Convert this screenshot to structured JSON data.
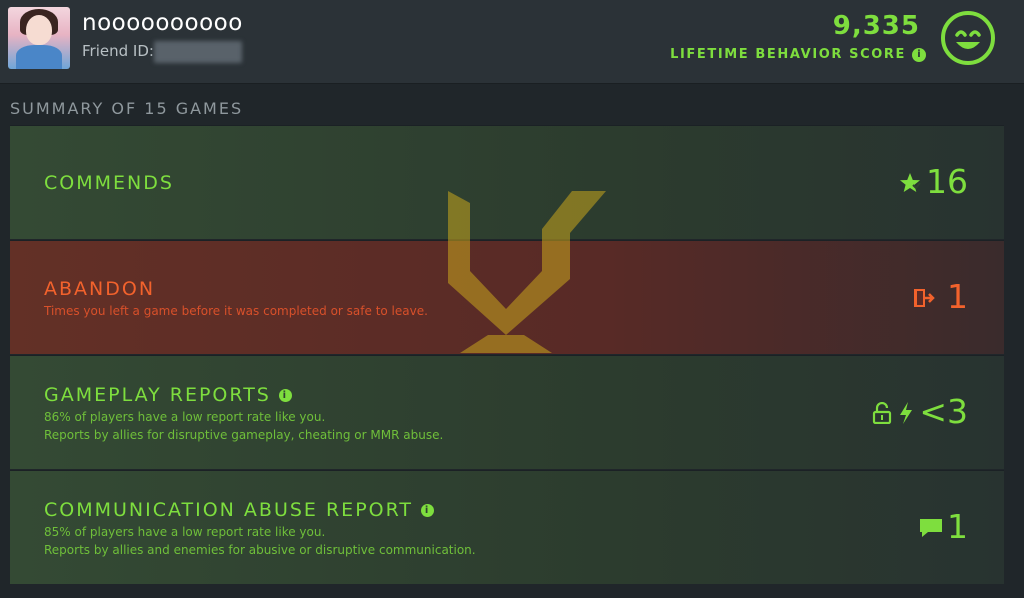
{
  "header": {
    "username": "noooooooooo",
    "friend_id_label": "Friend ID:",
    "score": "9,335",
    "score_label": "LIFETIME BEHAVIOR SCORE"
  },
  "summary_title": "SUMMARY OF 15 GAMES",
  "panels": {
    "commends": {
      "title": "COMMENDS",
      "value": "16",
      "icon": "star-icon"
    },
    "abandon": {
      "title": "ABANDON",
      "desc": "Times you left a game before it was completed or safe to leave.",
      "value": "1",
      "icon": "exit-door-icon"
    },
    "gameplay": {
      "title": "GAMEPLAY REPORTS",
      "desc1": "86% of players have a low report rate like you.",
      "desc2": "Reports by allies for disruptive gameplay, cheating or MMR abuse.",
      "value": "<3",
      "icons": [
        "lock-icon",
        "lightning-icon"
      ]
    },
    "comm": {
      "title": "COMMUNICATION ABUSE REPORT",
      "desc1": "85% of players have a low report rate like you.",
      "desc2": "Reports by allies and enemies for abusive or disruptive communication.",
      "value": "1",
      "icon": "chat-bubble-icon"
    }
  },
  "colors": {
    "accent_green": "#7ede3e",
    "accent_red": "#f2622c",
    "emblem_gold": "#c9a51e"
  }
}
